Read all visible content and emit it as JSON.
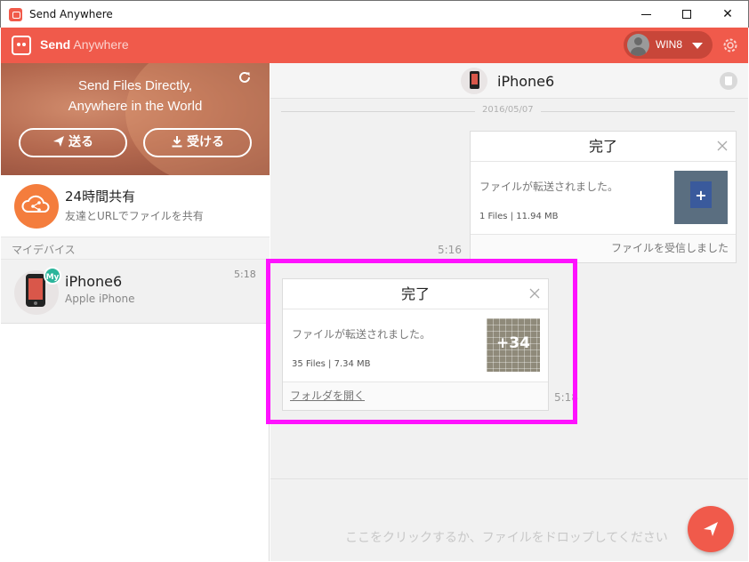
{
  "window": {
    "title": "Send Anywhere",
    "minimize_label": "",
    "maximize_label": "",
    "close_label": "✕"
  },
  "header": {
    "logo_bold": "Send",
    "logo_light": "Anywhere",
    "user_name": "WIN8"
  },
  "banner": {
    "line1": "Send Files Directly,",
    "line2": "Anywhere in the World",
    "send_label": "送る",
    "receive_label": "受ける"
  },
  "share": {
    "title": "24時間共有",
    "subtitle": "友達とURLでファイルを共有"
  },
  "devices_section": {
    "label": "マイデバイス",
    "items": [
      {
        "badge": "My",
        "name": "iPhone6",
        "subtitle": "Apple iPhone",
        "time": "5:18"
      }
    ]
  },
  "chat": {
    "title": "iPhone6",
    "date": "2016/05/07",
    "messages": [
      {
        "title": "完了",
        "message": "ファイルが転送されました。",
        "files": "1 Files | 11.94 MB",
        "thumb_label": "+",
        "footer": "ファイルを受信しました",
        "time": "5:16"
      },
      {
        "title": "完了",
        "message": "ファイルが転送されました。",
        "files": "35 Files | 7.34 MB",
        "thumb_label": "+34",
        "footer": "フォルダを開く",
        "time": "5:18"
      }
    ],
    "input_placeholder": "ここをクリックするか、ファイルをドロップしてください"
  },
  "colors": {
    "brand": "#f05a4b",
    "share_icon": "#f47d3d",
    "my_badge": "#2bb59b",
    "highlight": "#ff12ff"
  },
  "icons": {
    "app": "app-logo-icon",
    "settings": "gear-icon",
    "refresh": "refresh-icon",
    "send": "paper-plane-icon",
    "receive": "download-icon",
    "share": "cloud-share-icon",
    "delete": "trash-icon",
    "close": "close-icon"
  }
}
